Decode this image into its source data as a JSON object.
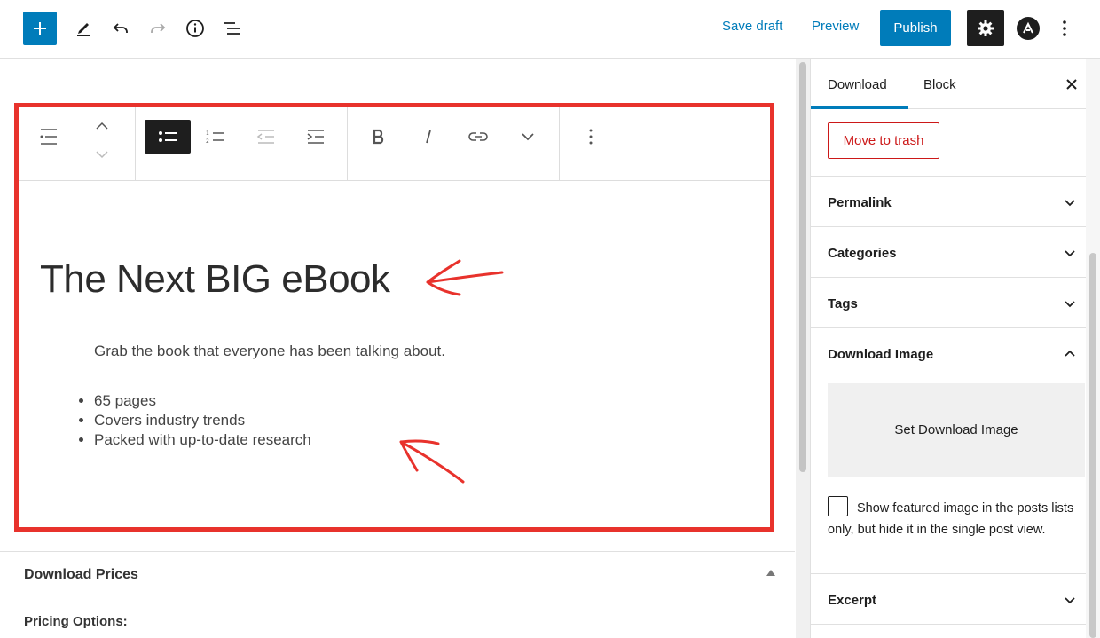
{
  "topbar": {
    "save_draft": "Save draft",
    "preview": "Preview",
    "publish": "Publish"
  },
  "editor": {
    "heading": "The Next BIG eBook",
    "paragraph": "Grab the book that everyone has been talking about.",
    "list_items": [
      "65 pages",
      "Covers industry trends",
      "Packed with up-to-date research"
    ],
    "highlight_color": "#e8322c"
  },
  "downloads": {
    "title": "Download Prices",
    "pricing_label": "Pricing Options:"
  },
  "sidebar": {
    "tabs": [
      "Download",
      "Block"
    ],
    "move_to_trash": "Move to trash",
    "panels": {
      "permalink": "Permalink",
      "categories": "Categories",
      "tags": "Tags",
      "download_image": "Download Image",
      "excerpt": "Excerpt"
    },
    "set_download_image": "Set Download Image",
    "featured_checkbox_label": "Show featured image in the posts lists only, but hide it in the single post view."
  },
  "colors": {
    "accent": "#007cba",
    "danger": "#cc1818",
    "dark": "#1e1e1e"
  }
}
